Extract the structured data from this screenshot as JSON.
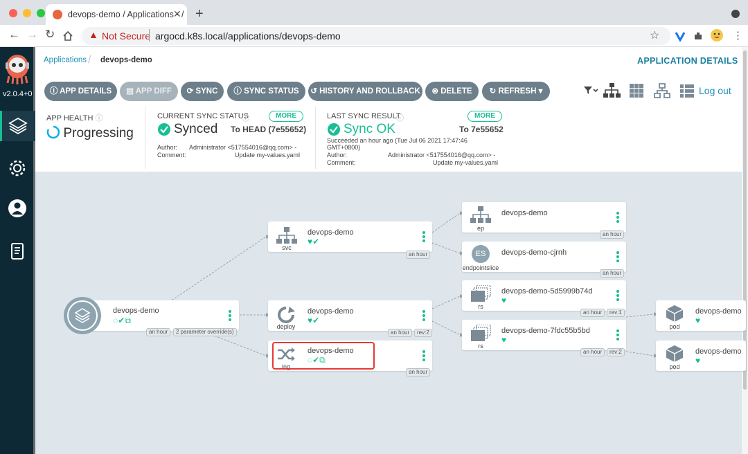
{
  "browser": {
    "tab_title": "devops-demo / Applications - /",
    "new_tab": "+",
    "not_secure": "Not Secure",
    "url": "argocd.k8s.local/applications/devops-demo"
  },
  "sidebar": {
    "version": "v2.0.4+0",
    "items": [
      "applications",
      "settings",
      "user-info",
      "documentation"
    ]
  },
  "breadcrumb": {
    "root": "Applications",
    "current": "devops-demo"
  },
  "page_title": "APPLICATION DETAILS",
  "toolbar": {
    "app_details": "APP DETAILS",
    "app_diff": "APP DIFF",
    "sync": "SYNC",
    "sync_status": "SYNC STATUS",
    "history": "HISTORY AND ROLLBACK",
    "delete": "DELETE",
    "refresh": "REFRESH",
    "logout": "Log out"
  },
  "status": {
    "health_label": "APP HEALTH",
    "health_value": "Progressing",
    "sync_label": "CURRENT SYNC STATUS",
    "sync_value": "Synced",
    "sync_to": "To HEAD (7e55652)",
    "more": "MORE",
    "author_label": "Author:",
    "comment_label": "Comment:",
    "author": "Administrator <517554016@qq.com> -",
    "comment": "Update my-values.yaml",
    "last_label": "LAST SYNC RESULT",
    "last_value": "Sync OK",
    "last_to": "To 7e55652",
    "last_time": "Succeeded an hour ago (Tue Jul 06 2021 17:47:46 GMT+0800)"
  },
  "graph": {
    "root": {
      "name": "devops-demo",
      "tags": [
        "an hour",
        "2 parameter override(s)"
      ]
    },
    "svc": {
      "name": "devops-demo",
      "kind": "svc",
      "tag": "an hour"
    },
    "deploy": {
      "name": "devops-demo",
      "kind": "deploy",
      "tags": [
        "an hour",
        "rev:2"
      ]
    },
    "ing": {
      "name": "devops-demo",
      "kind": "ing",
      "tag": "an hour"
    },
    "ep": {
      "name": "devops-demo",
      "kind": "ep",
      "tag": "an hour"
    },
    "eps": {
      "name": "devops-demo-cjrnh",
      "kind": "endpointslice",
      "tag": "an hour",
      "badge": "ES"
    },
    "rs1": {
      "name": "devops-demo-5d5999b74d",
      "kind": "rs",
      "tags": [
        "an hour",
        "rev:1"
      ]
    },
    "rs2": {
      "name": "devops-demo-7fdc55b5bd",
      "kind": "rs",
      "tags": [
        "an hour",
        "rev:2"
      ]
    },
    "pod1": {
      "name": "devops-demo",
      "kind": "pod"
    },
    "pod2": {
      "name": "devops-demo",
      "kind": "pod"
    }
  },
  "colors": {
    "accent": "#18be94",
    "sidebar": "#0c2935",
    "button": "#6d7f8b",
    "highlight": "#e53935"
  }
}
